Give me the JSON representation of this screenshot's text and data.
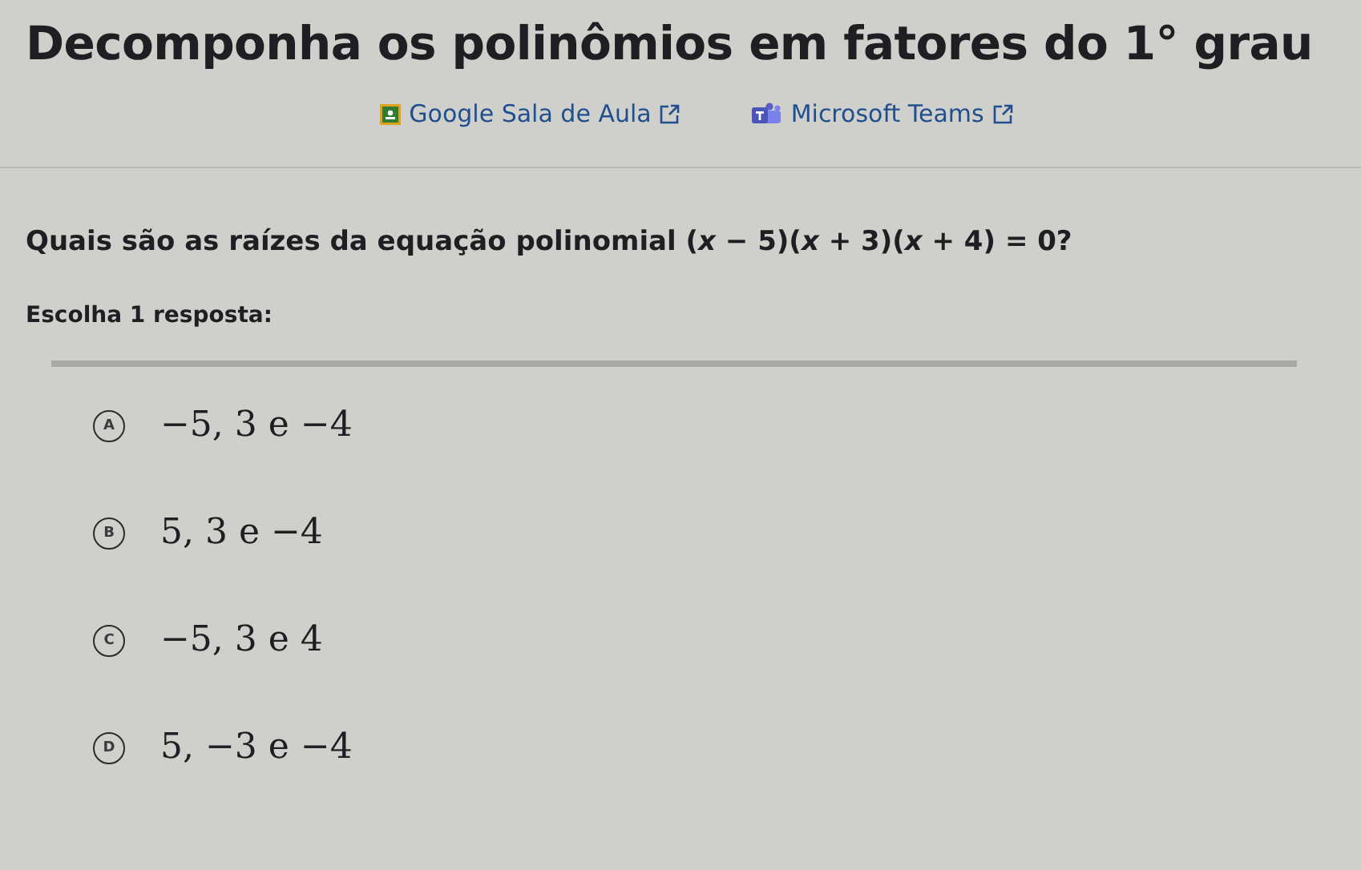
{
  "title": "Decomponha os polinômios em fatores do 1° grau",
  "links": [
    {
      "kind": "classroom",
      "label": "Google Sala de Aula"
    },
    {
      "kind": "teams",
      "label": "Microsoft Teams"
    }
  ],
  "question": "Quais são as raízes da equação polinomial (*x* − 5)(*x* + 3)(*x* + 4) = 0?",
  "instruction": "Escolha 1 resposta:",
  "options": [
    {
      "letter": "A",
      "text": "−5, 3 e −4",
      "selected": false
    },
    {
      "letter": "B",
      "text": "5, 3 e −4",
      "selected": false
    },
    {
      "letter": "C",
      "text": "−5, 3 e 4",
      "selected": false
    },
    {
      "letter": "D",
      "text": "5, −3 e −4",
      "selected": false
    }
  ]
}
